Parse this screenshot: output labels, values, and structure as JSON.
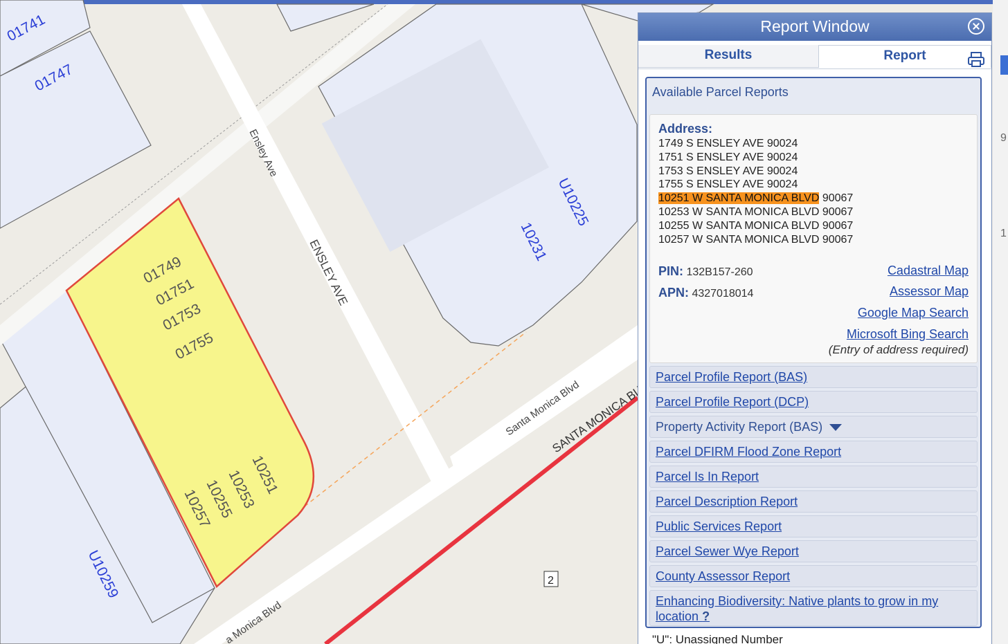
{
  "map": {
    "streets": {
      "ensley_small": "Ensley Ave",
      "ensley_large": "ENSLEY AVE",
      "santa_monica_small": "Santa Monica Blvd",
      "santa_monica_large": "SANTA MONICA BLVD",
      "santa_monica_bottom": "a Monica Blvd"
    },
    "parcel_labels": [
      "01741",
      "01747",
      "U10225",
      "10231",
      "U10259"
    ],
    "selected_parcel_top": [
      "01749",
      "01751",
      "01753",
      "01755"
    ],
    "selected_parcel_bottom": [
      "10251",
      "10253",
      "10255",
      "10257"
    ],
    "route_shield": "2",
    "edge_glyphs": [
      "9",
      "1"
    ],
    "colors": {
      "selected_fill": "#f7f58c",
      "selected_outline": "#e0483c",
      "parcel_fill": "#e8ecf8",
      "road_red": "#e8343f",
      "label_blue": "#2b3fd6"
    }
  },
  "panel": {
    "title": "Report Window",
    "tabs": [
      {
        "label": "Results"
      },
      {
        "label": "Report"
      }
    ],
    "header": "Available Parcel Reports",
    "address_label": "Address:",
    "addresses": [
      "1749 S ENSLEY AVE 90024",
      "1751 S ENSLEY AVE 90024",
      "1753 S ENSLEY AVE 90024",
      "1755 S ENSLEY AVE 90024",
      "10251 W SANTA MONICA BLVD",
      "10253 W SANTA MONICA BLVD 90067",
      "10255 W SANTA MONICA BLVD 90067",
      "10257 W SANTA MONICA BLVD 90067"
    ],
    "highlight_suffix": "90067",
    "pin_label": "PIN:",
    "pin_value": "132B157-260",
    "apn_label": "APN:",
    "apn_value": "4327018014",
    "links": [
      "Cadastral Map",
      "Assessor Map",
      "Google Map Search",
      "Microsoft Bing Search"
    ],
    "entry_note": "(Entry of address required)",
    "reports": [
      "Parcel Profile Report (BAS)",
      "Parcel Profile Report (DCP)",
      "Property Activity Report (BAS)",
      "Parcel DFIRM Flood Zone Report",
      "Parcel Is In Report",
      "Parcel Description Report",
      "Public Services Report",
      "Parcel Sewer Wye Report",
      "County Assessor Report",
      "Enhancing Biodiversity: Native plants to grow in my"
    ],
    "last_report_line2": "location",
    "help_mark": "?",
    "footnote": "\"U\": Unassigned Number",
    "colors": {
      "title_bar": "#5577bb",
      "link": "#1f47a8",
      "highlight": "#f7921e"
    }
  }
}
